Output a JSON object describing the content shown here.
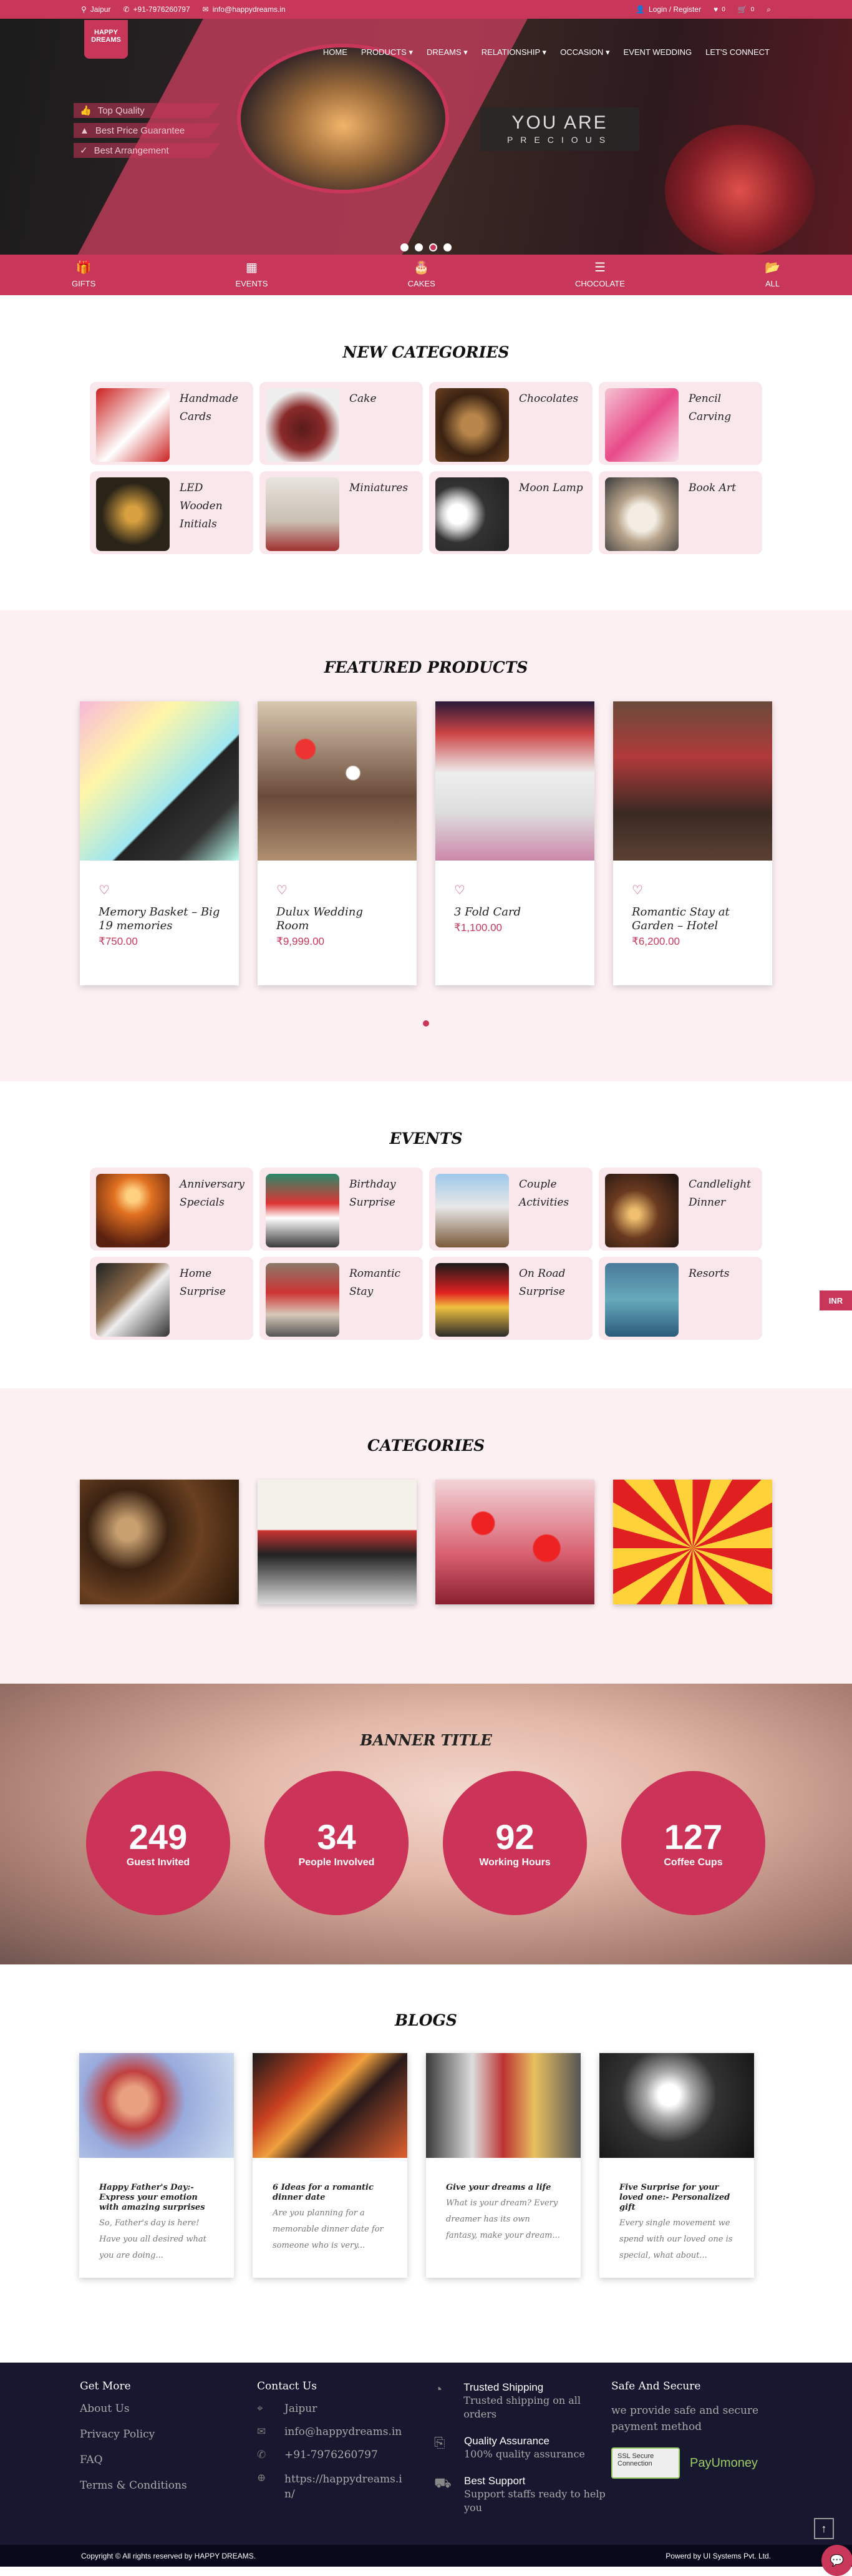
{
  "topbar": {
    "location": "Jaipur",
    "phone": "+91-7976260797",
    "email": "info@happydreams.in",
    "login": "Login / Register",
    "wishlist_count": "0",
    "cart_count": "0"
  },
  "brand": {
    "logo_text": "HAPPY DREAMS"
  },
  "nav": {
    "items": [
      "HOME",
      "PRODUCTS",
      "DREAMS",
      "RELATIONSHIP",
      "OCCASION",
      "EVENT WEDDING",
      "LET'S CONNECT"
    ]
  },
  "hero": {
    "features": [
      "Top Quality",
      "Best Price Guarantee",
      "Best Arrangement"
    ],
    "tagline_l1": "YOU ARE",
    "tagline_l2": "PRECIOUS"
  },
  "category_bar": {
    "items": [
      "GIFTS",
      "EVENTS",
      "CAKES",
      "CHOCOLATE",
      "ALL"
    ]
  },
  "new_categories": {
    "title": "NEW CATEGORIES",
    "items": [
      "Handmade Cards",
      "Cake",
      "Chocolates",
      "Pencil Carving",
      "LED Wooden Initials",
      "Miniatures",
      "Moon Lamp",
      "Book Art"
    ]
  },
  "featured": {
    "title": "FEATURED PRODUCTS",
    "items": [
      {
        "name": "Memory Basket – Big 19 memories",
        "price": "₹750.00"
      },
      {
        "name": "Dulux Wedding Room",
        "price": "₹9,999.00"
      },
      {
        "name": "3 Fold Card",
        "price": "₹1,100.00"
      },
      {
        "name": "Romantic Stay at Garden – Hotel",
        "price": "₹6,200.00"
      }
    ]
  },
  "events": {
    "title": "EVENTS",
    "items": [
      "Anniversary Specials",
      "Birthday Surprise",
      "Couple Activities",
      "Candlelight Dinner",
      "Home Surprise",
      "Romantic Stay",
      "On Road Surprise",
      "Resorts"
    ]
  },
  "categories": {
    "title": "CATEGORIES"
  },
  "banner": {
    "title": "BANNER TITLE",
    "counters": [
      {
        "value": "249",
        "label": "Guest Invited"
      },
      {
        "value": "34",
        "label": "People Involved"
      },
      {
        "value": "92",
        "label": "Working Hours"
      },
      {
        "value": "127",
        "label": "Coffee Cups"
      }
    ]
  },
  "blogs": {
    "title": "BLOGS",
    "items": [
      {
        "title": "Happy Father's Day:- Express your emotion with amazing surprises",
        "excerpt": "So, Father's day is here! Have you all desired what you are doing..."
      },
      {
        "title": "6 Ideas for a romantic dinner date",
        "excerpt": "Are you planning for a memorable dinner date for someone who is very..."
      },
      {
        "title": "Give your dreams a life",
        "excerpt": "What is your dream? Every dreamer has its own fantasy, make your dream..."
      },
      {
        "title": "Five Surprise for your loved one:- Personalized gift",
        "excerpt": "Every single movement we spend with our loved one is special, what about..."
      }
    ]
  },
  "footer": {
    "get_more": {
      "title": "Get More",
      "links": [
        "About Us",
        "Privacy Policy",
        "FAQ",
        "Terms & Conditions"
      ]
    },
    "contact": {
      "title": "Contact Us",
      "city": "Jaipur",
      "email": "info@happydreams.in",
      "phone": "+91-7976260797",
      "web": "https://happydreams.in/"
    },
    "services": [
      {
        "title": "Trusted Shipping",
        "desc": "Trusted shipping on all orders"
      },
      {
        "title": "Quality Assurance",
        "desc": "100% quality assurance"
      },
      {
        "title": "Best Support",
        "desc": "Support staffs ready to help you"
      }
    ],
    "secure": {
      "title": "Safe And Secure",
      "desc": "we provide safe and secure payment method",
      "ssl": "SSL Secure Connection",
      "payu": "PayUmoney"
    }
  },
  "bottom": {
    "copyright": "Copyright © All rights reserved by HAPPY DREAMS.",
    "powered": "Powerd by UI Systems Pvt. Ltd."
  },
  "currency_badge": "INR",
  "colors": {
    "accent": "#c8375a",
    "footer_bg": "#171830"
  }
}
